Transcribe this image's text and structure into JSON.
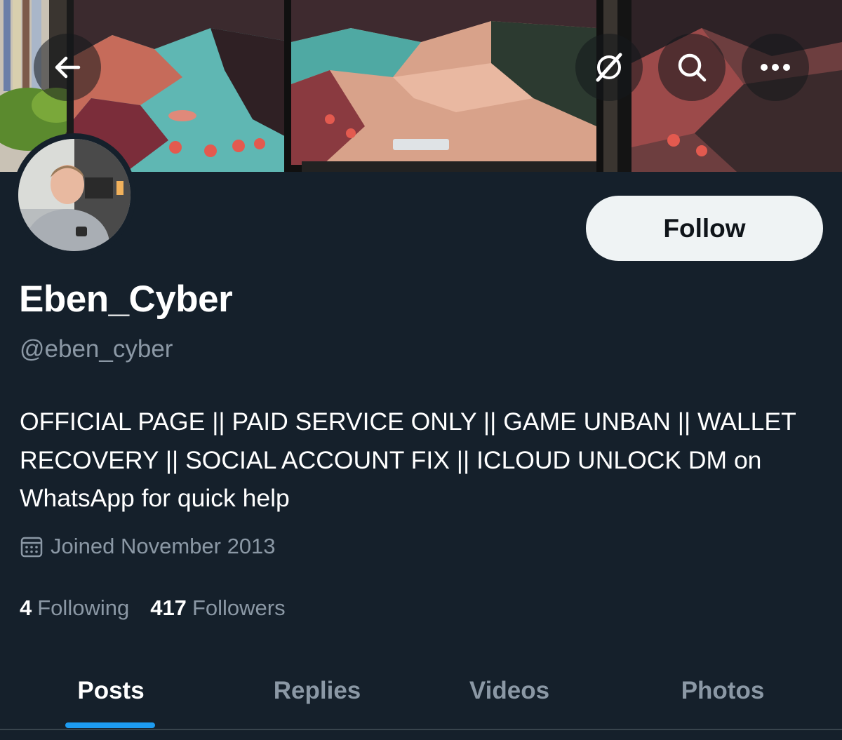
{
  "header": {
    "back_icon": "arrow-left-icon",
    "grok_icon": "grok-icon",
    "search_icon": "search-icon",
    "more_icon": "more-horizontal-icon"
  },
  "profile": {
    "display_name": "Eben_Cyber",
    "handle": "@eben_cyber",
    "bio": "OFFICIAL PAGE || PAID SERVICE ONLY || GAME UNBAN || WALLET RECOVERY || SOCIAL ACCOUNT FIX || ICLOUD UNLOCK DM on WhatsApp for quick help",
    "joined": "Joined November 2013",
    "follow_label": "Follow",
    "following_count": "4",
    "following_label": "Following",
    "followers_count": "417",
    "followers_label": "Followers"
  },
  "tabs": [
    {
      "label": "Posts",
      "active": true
    },
    {
      "label": "Replies",
      "active": false
    },
    {
      "label": "Videos",
      "active": false
    },
    {
      "label": "Photos",
      "active": false
    }
  ],
  "colors": {
    "background": "#15202b",
    "accent": "#1d9bf0",
    "secondary_text": "#8b98a5",
    "follow_button_bg": "#eff3f4"
  }
}
